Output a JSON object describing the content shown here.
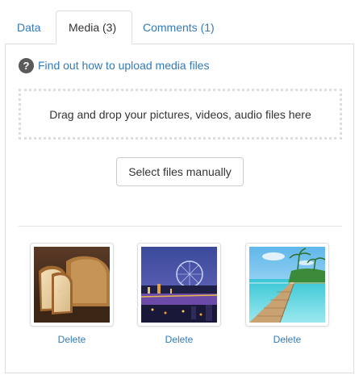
{
  "tabs": [
    {
      "label": "Data"
    },
    {
      "label": "Media (3)"
    },
    {
      "label": "Comments (1)"
    }
  ],
  "help": {
    "icon": "question-circle-icon",
    "icon_glyph": "?",
    "link_text": "Find out how to upload media files"
  },
  "dropzone": {
    "text": "Drag and drop your pictures, videos, audio files here"
  },
  "select_button": {
    "label": "Select files manually"
  },
  "media": [
    {
      "thumbnail": "bread-photo",
      "delete_label": "Delete"
    },
    {
      "thumbnail": "london-eye-night-photo",
      "delete_label": "Delete"
    },
    {
      "thumbnail": "tropical-pier-photo",
      "delete_label": "Delete"
    }
  ],
  "colors": {
    "link": "#337ab7",
    "border": "#dddddd",
    "text": "#333333",
    "help_icon_bg": "#5a5a5a"
  }
}
